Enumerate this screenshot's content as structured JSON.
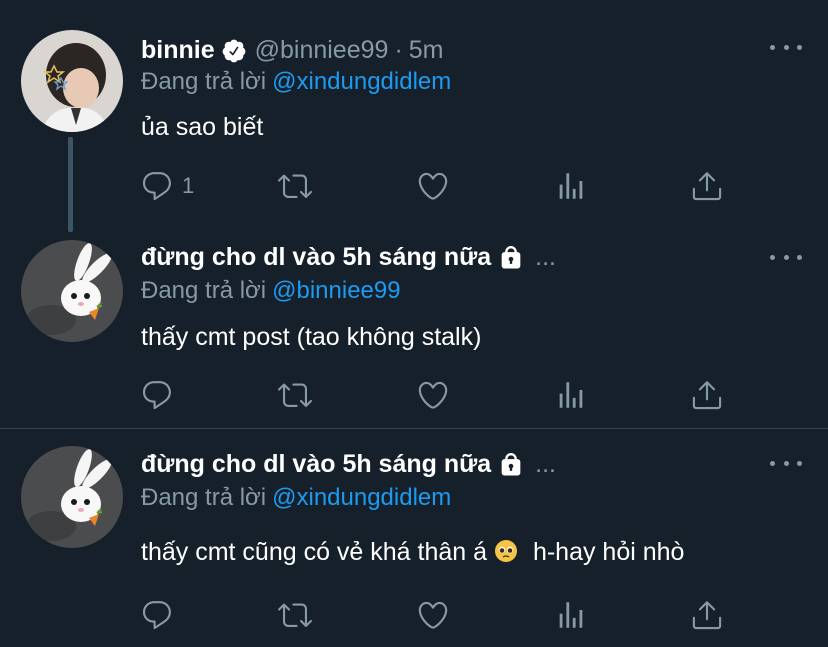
{
  "tweets": [
    {
      "display_name": "binnie",
      "verified": true,
      "handle": "@binniee99",
      "time_sep": "·",
      "time": "5m",
      "reply_prefix": "Đang trả lời",
      "reply_to": "@xindungdidlem",
      "text": "ủa sao biết",
      "reply_count": "1"
    },
    {
      "display_name": "đừng cho dl vào 5h sáng nữa",
      "protected": true,
      "truncation": "...",
      "reply_prefix": "Đang trả lời",
      "reply_to": "@binniee99",
      "text": "thấy cmt post (tao không stalk)"
    },
    {
      "display_name": "đừng cho dl vào 5h sáng nữa",
      "protected": true,
      "truncation": "...",
      "reply_prefix": "Đang trả lời",
      "reply_to": "@xindungdidlem",
      "text_before_emoji": "thấy cmt cũng có vẻ khá thân á",
      "emoji": "pleading-face-emoji",
      "text_after_emoji": "h-hay hỏi nhò"
    }
  ],
  "colors": {
    "background": "#15202b",
    "secondary_text": "#8899a6",
    "mention": "#1d9bf0",
    "divider": "#38444d"
  }
}
